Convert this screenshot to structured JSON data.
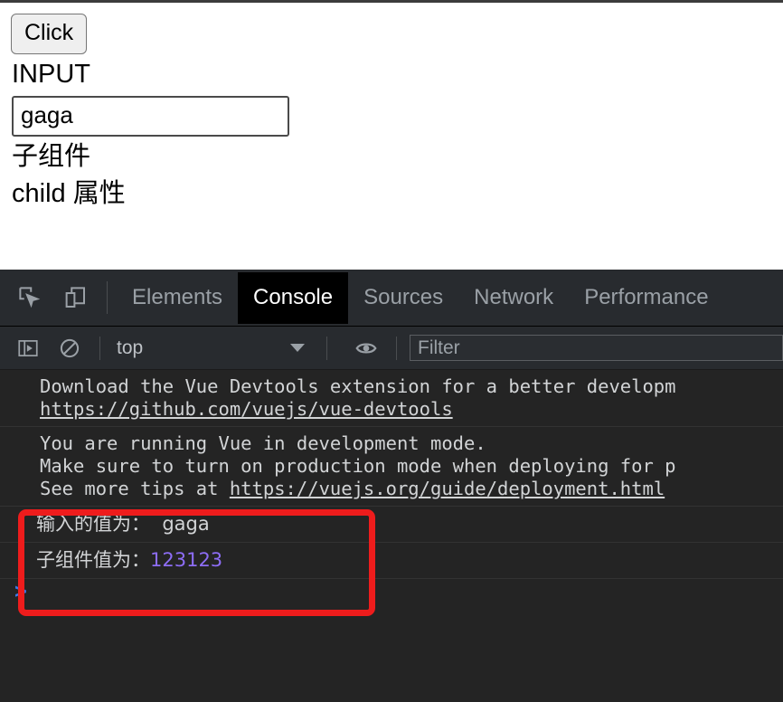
{
  "page": {
    "button_label": "Click",
    "input_heading": "INPUT",
    "input_value": "gaga",
    "input_placeholder": "",
    "child_component_heading": "子组件",
    "child_property_text": "child 属性"
  },
  "devtools": {
    "icons": {
      "inspect": "inspect-element-icon",
      "device": "device-toolbar-icon",
      "sidebar": "console-sidebar-icon",
      "clear": "clear-console-icon",
      "eye": "live-expression-icon",
      "caret": "chevron-down-icon"
    },
    "tabs": [
      {
        "label": "Elements",
        "active": false
      },
      {
        "label": "Console",
        "active": true
      },
      {
        "label": "Sources",
        "active": false
      },
      {
        "label": "Network",
        "active": false
      },
      {
        "label": "Performance",
        "active": false
      }
    ],
    "toolbar": {
      "context": "top",
      "filter_placeholder": "Filter",
      "filter_value": ""
    },
    "messages": [
      {
        "kind": "info",
        "line1": "Download the Vue Devtools extension for a better developm",
        "line2": "https://github.com/vuejs/vue-devtools"
      },
      {
        "kind": "warning",
        "line1": "You are running Vue in development mode.",
        "line2": "Make sure to turn on production mode when deploying for p",
        "line3_pre": "See more tips at ",
        "line3_link": "https://vuejs.org/guide/deployment.html"
      },
      {
        "kind": "log-cn",
        "label": "输入的值为：",
        "value": "  gaga",
        "value_color": "default"
      },
      {
        "kind": "log-cn",
        "label": "子组件值为：",
        "value": "123123",
        "value_color": "purple"
      }
    ],
    "prompt_caret": ">"
  },
  "annotation": {
    "color": "#ee1c1c",
    "name": "red-highlight-box"
  }
}
